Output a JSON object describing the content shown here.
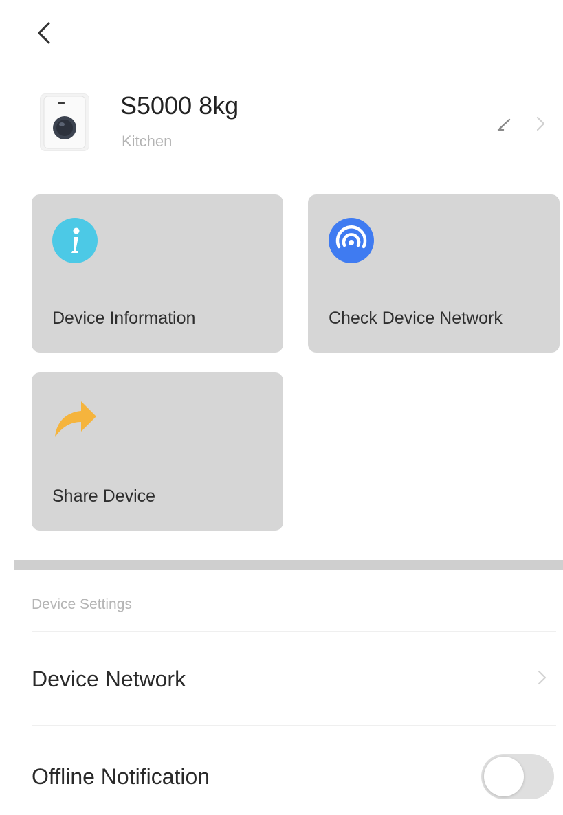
{
  "header": {
    "device_name": "S5000 8kg",
    "room": "Kitchen"
  },
  "actions": [
    {
      "label": "Device Information",
      "icon": "info-icon",
      "color": "#4cc9e6"
    },
    {
      "label": "Check Device Network",
      "icon": "network-signal-icon",
      "color": "#3f7bf1"
    },
    {
      "label": "Share Device",
      "icon": "share-arrow-icon",
      "color": "#f5b43d"
    }
  ],
  "settings": {
    "section_title": "Device Settings",
    "device_network_label": "Device Network",
    "offline_notification_label": "Offline Notification",
    "offline_notification_enabled": false
  },
  "colors": {
    "card_background": "#d6d6d6",
    "info_icon": "#4cc9e6",
    "network_icon": "#3f7bf1",
    "share_icon": "#f5b43d"
  }
}
